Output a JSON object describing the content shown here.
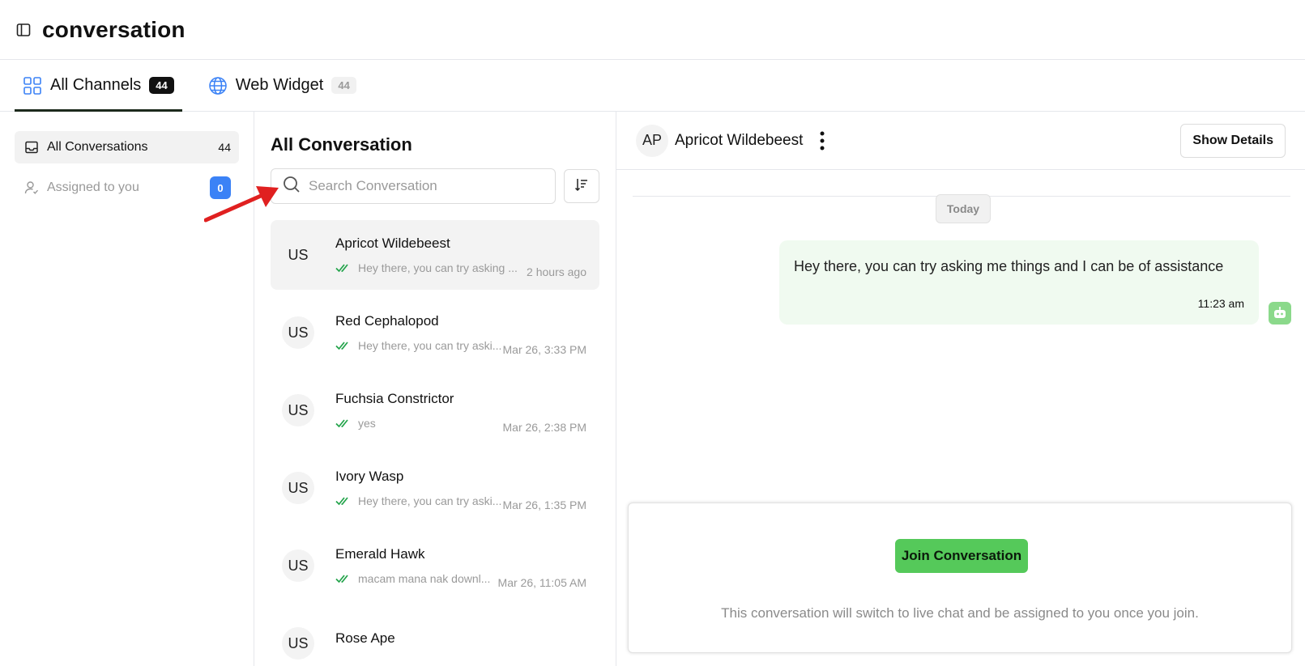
{
  "header": {
    "title": "conversation"
  },
  "tabs": [
    {
      "label": "All Channels",
      "count": "44",
      "icon": "grid-icon",
      "active": true
    },
    {
      "label": "Web Widget",
      "count": "44",
      "icon": "globe-icon",
      "active": false
    }
  ],
  "sidebar": {
    "items": [
      {
        "label": "All Conversations",
        "count": "44",
        "icon": "inbox-icon"
      },
      {
        "label": "Assigned to you",
        "count": "0",
        "icon": "user-check-icon"
      }
    ]
  },
  "list": {
    "title": "All Conversation",
    "search_placeholder": "Search Conversation",
    "conversations": [
      {
        "initials": "US",
        "name": "Apricot Wildebeest",
        "preview": "Hey there, you can try asking ...",
        "time": "2 hours ago"
      },
      {
        "initials": "US",
        "name": "Red Cephalopod",
        "preview": "Hey there, you can try aski...",
        "time": "Mar 26, 3:33 PM"
      },
      {
        "initials": "US",
        "name": "Fuchsia Constrictor",
        "preview": "yes",
        "time": "Mar 26, 2:38 PM"
      },
      {
        "initials": "US",
        "name": "Ivory Wasp",
        "preview": "Hey there, you can try aski...",
        "time": "Mar 26, 1:35 PM"
      },
      {
        "initials": "US",
        "name": "Emerald Hawk",
        "preview": "macam mana nak downl...",
        "time": "Mar 26, 11:05 AM"
      },
      {
        "initials": "US",
        "name": "Rose Ape",
        "preview": "",
        "time": ""
      }
    ]
  },
  "chat": {
    "contact_initials": "AP",
    "contact_name": "Apricot Wildebeest",
    "show_details_label": "Show Details",
    "date_label": "Today",
    "message": {
      "text": "Hey there, you can try asking me things and I can be of assistance",
      "time": "11:23 am"
    },
    "join_button_label": "Join Conversation",
    "join_note": "This conversation will switch to live chat and be assigned to you once you join."
  },
  "colors": {
    "accent_green": "#55c95a",
    "badge_blue": "#3b82f6",
    "annotation_red": "#e02020"
  }
}
